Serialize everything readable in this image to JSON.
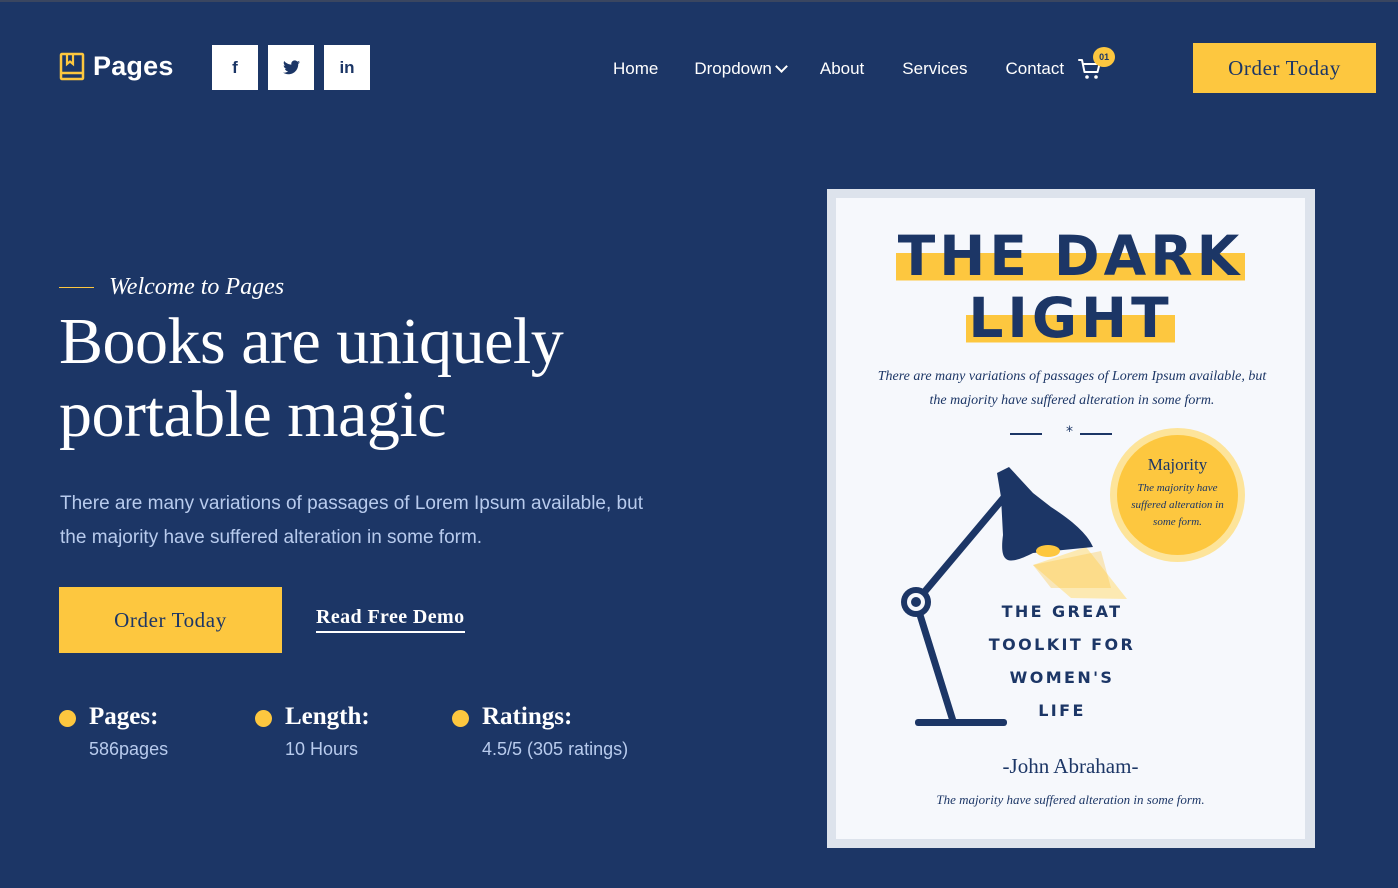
{
  "header": {
    "logo_text": "Pages",
    "socials": [
      {
        "icon": "facebook-icon",
        "glyph": "f"
      },
      {
        "icon": "twitter-icon",
        "glyph": "t"
      },
      {
        "icon": "linkedin-icon",
        "glyph": "in"
      }
    ],
    "nav": {
      "home": "Home",
      "dropdown": "Dropdown",
      "about": "About",
      "services": "Services",
      "contact": "Contact"
    },
    "cart_count": "01",
    "order_button": "Order Today"
  },
  "hero": {
    "welcome": "Welcome to Pages",
    "headline": "Books are uniquely portable magic",
    "description": "There are many variations of passages of Lorem Ipsum available, but the majority have suffered alteration in some form.",
    "order_button": "Order Today",
    "demo_link": "Read Free Demo",
    "stats": [
      {
        "label": "Pages:",
        "value": "586pages"
      },
      {
        "label": "Length:",
        "value": "10 Hours"
      },
      {
        "label": "Ratings:",
        "value": "4.5/5 (305 ratings)"
      }
    ]
  },
  "book": {
    "title_line1": "THE DARK",
    "title_line2": "LIGHT",
    "subtitle": "There are many variations of passages of Lorem Ipsum available, but the majority have suffered alteration in some form.",
    "badge_title": "Majority",
    "badge_text": "The majority have suffered alteration in some form.",
    "toolkit_lines": [
      "THE GREAT",
      "TOOLKIT FOR",
      "WOMEN'S",
      "LIFE"
    ],
    "author": "-John Abraham-",
    "footer": "The majority have suffered alteration in some form."
  },
  "colors": {
    "background": "#1c3666",
    "accent": "#fdc73f",
    "muted_text": "#b8cbed",
    "book_page": "#f6f8fc"
  }
}
